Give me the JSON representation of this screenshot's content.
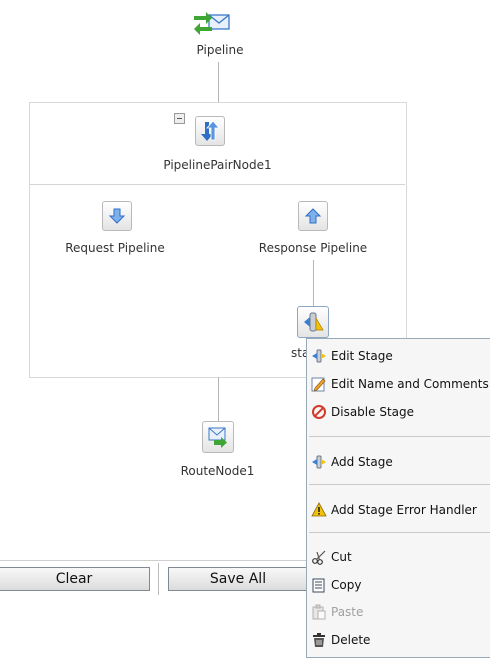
{
  "canvas": {
    "pipeline_label": "Pipeline",
    "pair_node_label": "PipelinePairNode1",
    "request_label": "Request Pipeline",
    "response_label": "Response Pipeline",
    "stage_label_partial": "sta",
    "route_label": "RouteNode1"
  },
  "toolbar": {
    "clear_label": "Clear",
    "save_all_label": "Save All"
  },
  "context_menu": {
    "items": [
      {
        "label": "Edit Stage",
        "icon": "stage-icon",
        "disabled": false
      },
      {
        "label": "Edit Name and Comments",
        "icon": "pencil-icon",
        "disabled": false
      },
      {
        "label": "Disable Stage",
        "icon": "disable-icon",
        "disabled": false
      },
      {
        "label": "Add Stage",
        "icon": "stage-icon",
        "disabled": false
      },
      {
        "label": "Add Stage Error Handler",
        "icon": "warning-icon",
        "disabled": false
      },
      {
        "label": "Cut",
        "icon": "scissors-icon",
        "disabled": false
      },
      {
        "label": "Copy",
        "icon": "copy-icon",
        "disabled": false
      },
      {
        "label": "Paste",
        "icon": "paste-icon",
        "disabled": true
      },
      {
        "label": "Delete",
        "icon": "trash-icon",
        "disabled": false
      }
    ]
  },
  "colors": {
    "arrow_green": "#3fa535",
    "arrow_blue": "#2f6fc6",
    "menu_border": "#9aa9b6",
    "disable_red": "#d23a2a",
    "warning_yellow": "#f2c20b"
  }
}
